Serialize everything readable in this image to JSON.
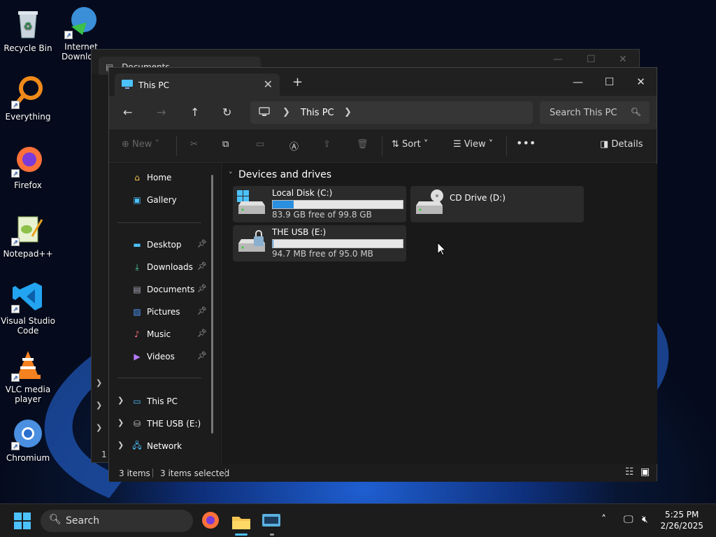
{
  "desktop": {
    "icons": [
      {
        "label": "Recycle Bin"
      },
      {
        "label": "Internet Downlo..."
      },
      {
        "label": "Everything"
      },
      {
        "label": "Firefox"
      },
      {
        "label": "Notepad++"
      },
      {
        "label": "Visual Studio Code"
      },
      {
        "label": "VLC media player"
      },
      {
        "label": "Chromium"
      }
    ]
  },
  "background_window": {
    "tab_title": "Documents",
    "status_text": "1 i"
  },
  "window": {
    "tab_title": "This PC",
    "breadcrumb": {
      "current": "This PC"
    },
    "search_placeholder": "Search This PC",
    "commands": {
      "new": "New",
      "sort": "Sort",
      "view": "View",
      "details": "Details"
    },
    "sidebar": {
      "top": [
        {
          "label": "Home"
        },
        {
          "label": "Gallery"
        }
      ],
      "pinned": [
        {
          "label": "Desktop"
        },
        {
          "label": "Downloads"
        },
        {
          "label": "Documents"
        },
        {
          "label": "Pictures"
        },
        {
          "label": "Music"
        },
        {
          "label": "Videos"
        }
      ],
      "tree": [
        {
          "label": "This PC"
        },
        {
          "label": "THE USB (E:)"
        },
        {
          "label": "Network"
        }
      ]
    },
    "content": {
      "group_header": "Devices and drives",
      "drives": [
        {
          "name": "Local Disk (C:)",
          "free_text": "83.9 GB free of 99.8 GB",
          "used_fraction": 0.16
        },
        {
          "name": "CD Drive (D:)"
        },
        {
          "name": "THE USB (E:)",
          "free_text": "94.7 MB free of 95.0 MB",
          "used_fraction": 0.003
        }
      ]
    },
    "status": {
      "items": "3 items",
      "selected": "3 items selected"
    }
  },
  "taskbar": {
    "search_placeholder": "Search",
    "time": "5:25 PM",
    "date": "2/26/2025"
  }
}
